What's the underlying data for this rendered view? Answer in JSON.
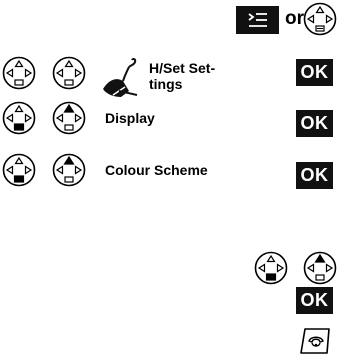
{
  "header": {
    "or_text": "or"
  },
  "steps": [
    {
      "text_line1": "H/Set Set-",
      "text_line2": "tings",
      "ok": "OK"
    },
    {
      "text": "Display",
      "ok": "OK"
    },
    {
      "text": "Colour Scheme",
      "ok": "OK"
    }
  ],
  "final": {
    "ok": "OK"
  },
  "icons": {
    "menu_key": "menu-key-icon",
    "nav_plain": "control-key-icon",
    "nav_down": "control-key-down-icon",
    "nav_up": "control-key-up-icon",
    "handset": "handset-settings-icon",
    "end_call": "end-call-key-icon"
  }
}
